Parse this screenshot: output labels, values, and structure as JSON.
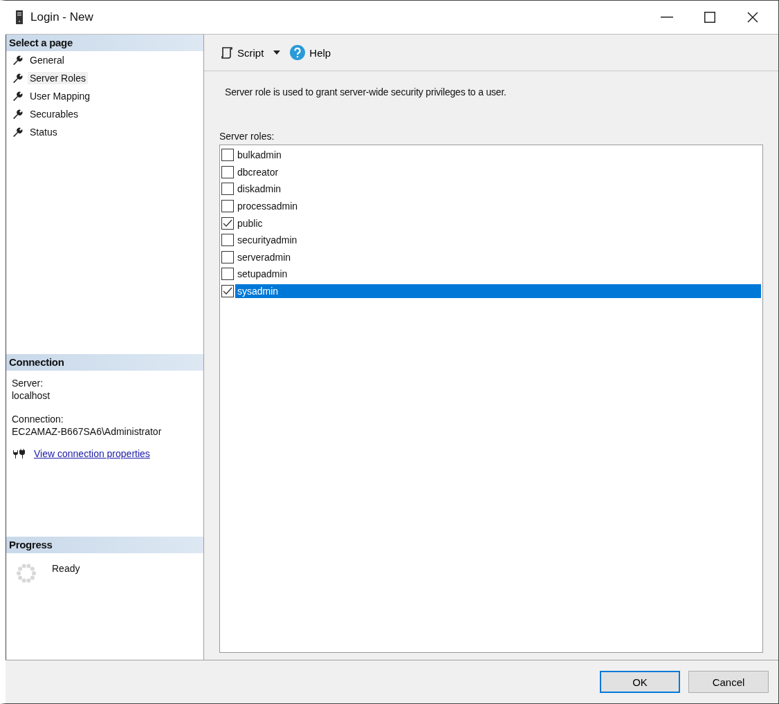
{
  "window": {
    "title": "Login - New"
  },
  "sidebar": {
    "heading": "Select a page",
    "items": [
      {
        "label": "General",
        "selected": false
      },
      {
        "label": "Server Roles",
        "selected": true
      },
      {
        "label": "User Mapping",
        "selected": false
      },
      {
        "label": "Securables",
        "selected": false
      },
      {
        "label": "Status",
        "selected": false
      }
    ]
  },
  "connection": {
    "heading": "Connection",
    "server_label": "Server:",
    "server": "localhost",
    "connection_label": "Connection:",
    "connection": "EC2AMAZ-B667SA6\\Administrator",
    "link": "View connection properties"
  },
  "progress": {
    "heading": "Progress",
    "status": "Ready"
  },
  "toolbar": {
    "script": "Script",
    "help": "Help"
  },
  "description": "Server role is used to grant server-wide security privileges to a user.",
  "roles": {
    "label": "Server roles:",
    "items": [
      {
        "name": "bulkadmin",
        "checked": false,
        "selected": false
      },
      {
        "name": "dbcreator",
        "checked": false,
        "selected": false
      },
      {
        "name": "diskadmin",
        "checked": false,
        "selected": false
      },
      {
        "name": "processadmin",
        "checked": false,
        "selected": false
      },
      {
        "name": "public",
        "checked": true,
        "selected": false
      },
      {
        "name": "securityadmin",
        "checked": false,
        "selected": false
      },
      {
        "name": "serveradmin",
        "checked": false,
        "selected": false
      },
      {
        "name": "setupadmin",
        "checked": false,
        "selected": false
      },
      {
        "name": "sysadmin",
        "checked": true,
        "selected": true
      }
    ]
  },
  "buttons": [
    {
      "label": "OK",
      "default": true
    },
    {
      "label": "Cancel",
      "default": false
    }
  ]
}
